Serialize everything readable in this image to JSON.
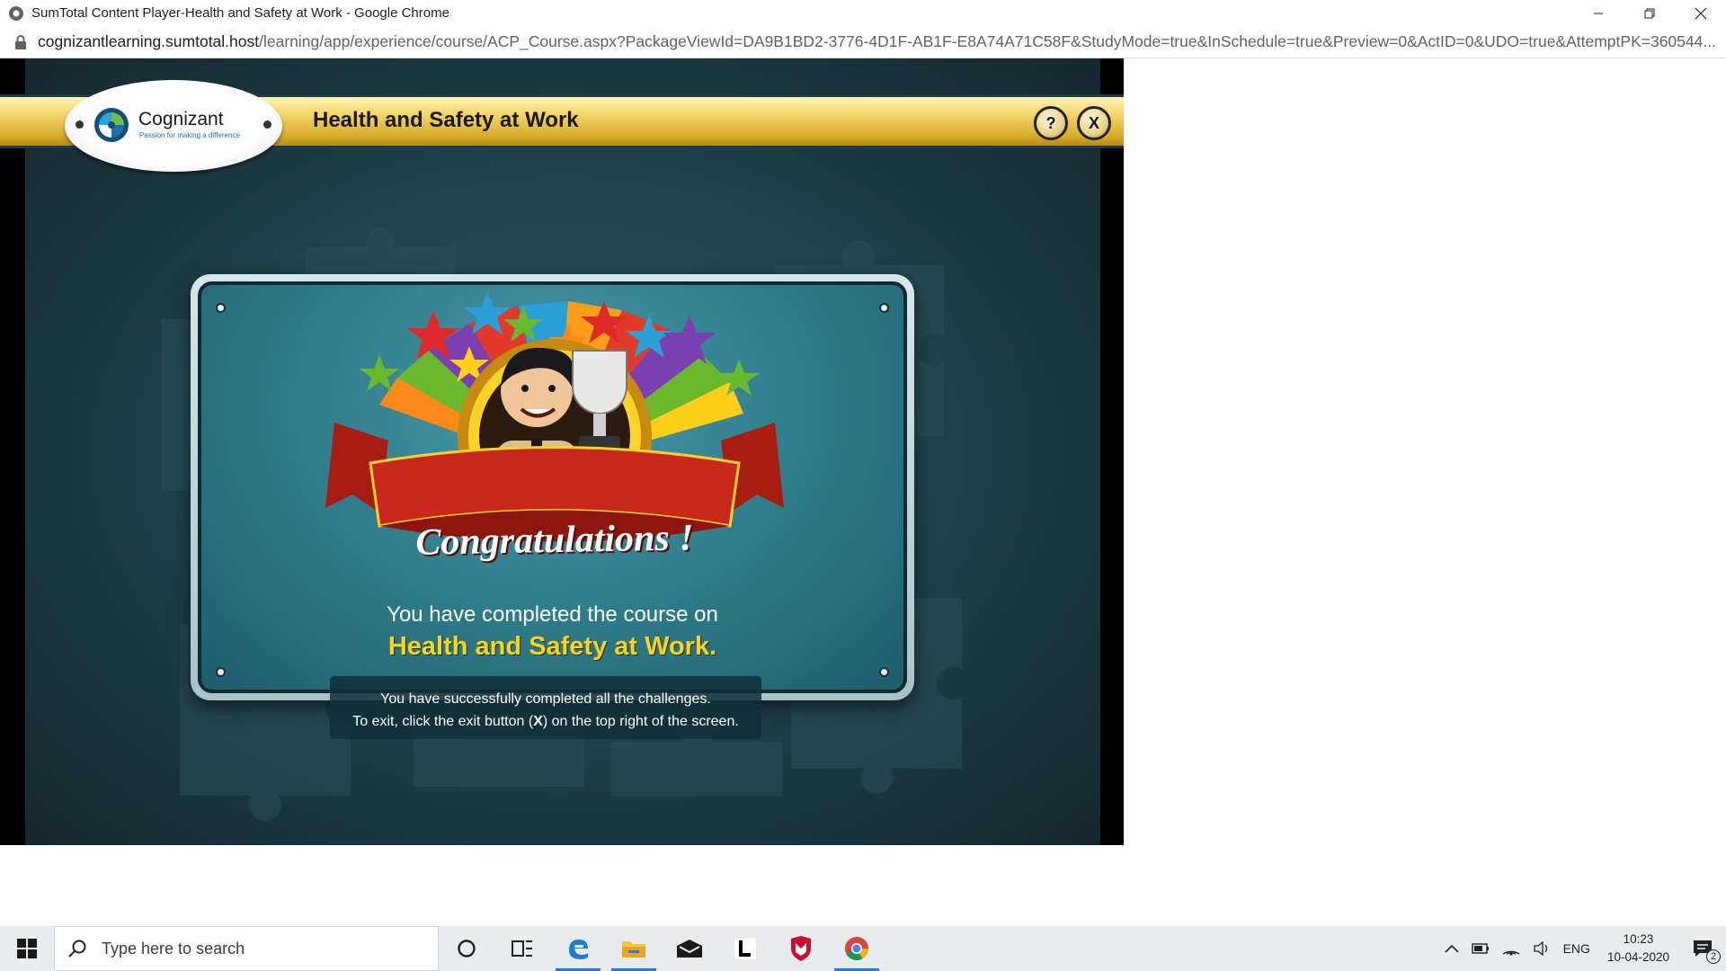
{
  "window": {
    "title": "SumTotal Content Player-Health and Safety at Work - Google Chrome",
    "controls": [
      "minimize",
      "restore",
      "close"
    ]
  },
  "address_bar": {
    "host": "cognizantlearning.sumtotal.host",
    "path": "/learning/app/experience/course/ACP_Course.aspx?PackageViewId=DA9B1BD2-3776-4D1F-AB1F-E8A74A71C58F&StudyMode=true&InSchedule=true&Preview=0&ActID=0&UDO=true&AttemptPK=360544..."
  },
  "player": {
    "logo_name": "Cognizant",
    "logo_tagline": "Passion for making a difference",
    "course_title": "Health and Safety at Work",
    "help_label": "?",
    "exit_label": "X",
    "congrats_text": "Congratulations !",
    "completed_line": "You have completed the course on",
    "course_name_line": "Health and Safety at Work.",
    "info_line1": "You have successfully completed all the challenges.",
    "info_line2_prefix": "To exit, click the exit button (",
    "info_line2_key": "X",
    "info_line2_suffix": ") on the top right of the screen."
  },
  "taskbar": {
    "search_placeholder": "Type here to search",
    "apps": [
      "cortana-icon",
      "task-view-icon",
      "edge-icon",
      "file-explorer-icon",
      "mail-icon",
      "l-app-icon",
      "mcafee-icon",
      "chrome-icon"
    ],
    "language": "ENG",
    "time": "10:23",
    "date": "10-04-2020",
    "notification_count": "2"
  },
  "colors": {
    "banner_gold": "#f3d66b",
    "panel_teal": "#2d7a89",
    "course_name_yellow": "#ffd21a",
    "ribbon_red": "#c0261a"
  }
}
